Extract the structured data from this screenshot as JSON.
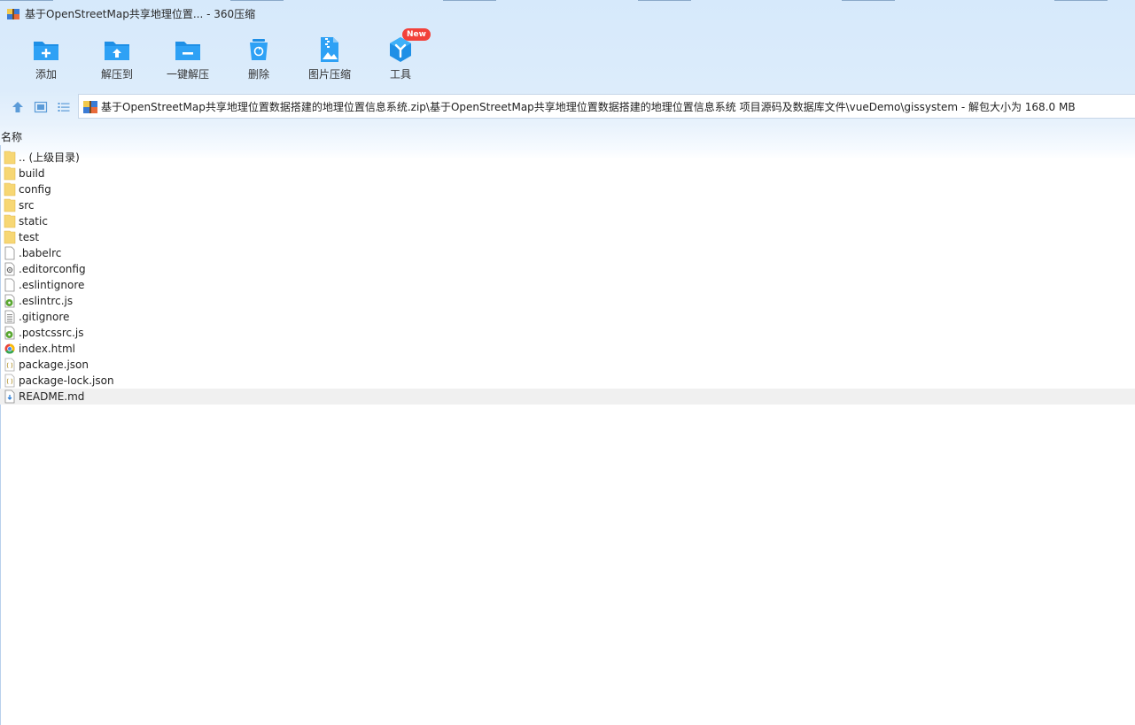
{
  "window": {
    "title": "基于OpenStreetMap共享地理位置... - 360压缩"
  },
  "toolbar": {
    "items": [
      {
        "label": "添加",
        "icon": "add-folder-icon"
      },
      {
        "label": "解压到",
        "icon": "extract-to-icon"
      },
      {
        "label": "一键解压",
        "icon": "one-click-extract-icon"
      },
      {
        "label": "删除",
        "icon": "delete-bin-icon"
      },
      {
        "label": "图片压缩",
        "icon": "image-compress-icon"
      },
      {
        "label": "工具",
        "icon": "tools-icon",
        "badge": "New"
      }
    ]
  },
  "nav": {
    "path": "基于OpenStreetMap共享地理位置数据搭建的地理位置信息系统.zip\\基于OpenStreetMap共享地理位置数据搭建的地理位置信息系统 项目源码及数据库文件\\vueDemo\\gissystem - 解包大小为 168.0 MB"
  },
  "list": {
    "column_name": "名称",
    "files": [
      {
        "name": ".. (上级目录)",
        "type": "folder"
      },
      {
        "name": "build",
        "type": "folder"
      },
      {
        "name": "config",
        "type": "folder"
      },
      {
        "name": "src",
        "type": "folder"
      },
      {
        "name": "static",
        "type": "folder"
      },
      {
        "name": "test",
        "type": "folder"
      },
      {
        "name": ".babelrc",
        "type": "file"
      },
      {
        "name": ".editorconfig",
        "type": "config"
      },
      {
        "name": ".eslintignore",
        "type": "file"
      },
      {
        "name": ".eslintrc.js",
        "type": "js"
      },
      {
        "name": ".gitignore",
        "type": "text"
      },
      {
        "name": ".postcssrc.js",
        "type": "js"
      },
      {
        "name": "index.html",
        "type": "html"
      },
      {
        "name": "package.json",
        "type": "json"
      },
      {
        "name": "package-lock.json",
        "type": "json"
      },
      {
        "name": "README.md",
        "type": "md",
        "selected": true
      }
    ]
  },
  "colors": {
    "accent": "#1e8fe6",
    "badge": "#f2413a",
    "folder": "#f7d774",
    "selected_row": "#f0f0f0"
  }
}
